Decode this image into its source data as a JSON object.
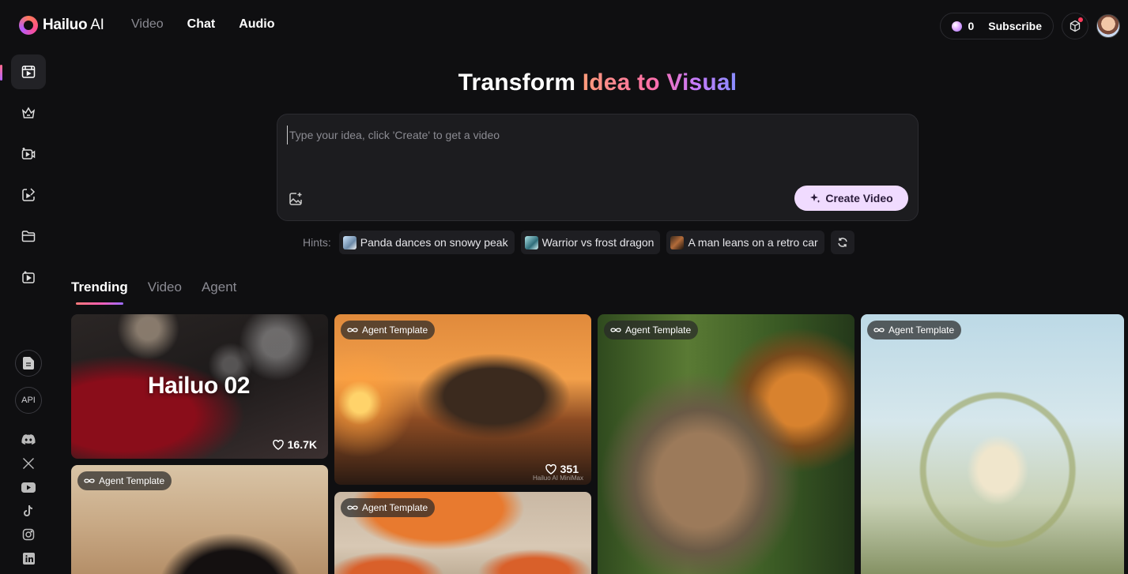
{
  "brand": {
    "name_bold": "Hailuo",
    "name_light": " AI"
  },
  "nav": {
    "items": [
      "Video",
      "Chat",
      "Audio"
    ]
  },
  "account": {
    "credits": "0",
    "subscribe_label": "Subscribe"
  },
  "sidebar": {
    "items": [
      "video-icon",
      "crown-icon",
      "video-plus-icon",
      "image-to-video-icon",
      "folder-icon",
      "clip-icon"
    ],
    "bottom": {
      "api_label": "API"
    },
    "social": [
      "discord-icon",
      "x-icon",
      "youtube-icon",
      "tiktok-icon",
      "instagram-icon",
      "linkedin-icon"
    ]
  },
  "hero": {
    "title_plain": "Transform ",
    "title_accent": "Idea to Visual"
  },
  "prompt": {
    "placeholder": "Type your idea, click 'Create' to get a video",
    "value": "",
    "create_label": "Create Video"
  },
  "hints": {
    "label": "Hints:",
    "items": [
      "Panda dances on snowy peak",
      "Warrior vs frost dragon",
      "A man leans on a retro car"
    ]
  },
  "tabs": {
    "items": [
      "Trending",
      "Video",
      "Agent"
    ],
    "active": "Trending"
  },
  "cards": [
    {
      "title": "Hailuo 02",
      "likes": "16.7K"
    },
    {
      "badge": "Agent Template",
      "likes": "351",
      "watermark": "Hailuo AI  MiniMax"
    },
    {
      "badge": "Agent Template"
    },
    {
      "badge": "Agent Template"
    },
    {
      "badge": "Agent Template"
    },
    {
      "badge": "Agent Template"
    }
  ],
  "colors": {
    "accent": "#f0dbff",
    "background": "#0f0f11",
    "panel": "#1c1c1f"
  }
}
